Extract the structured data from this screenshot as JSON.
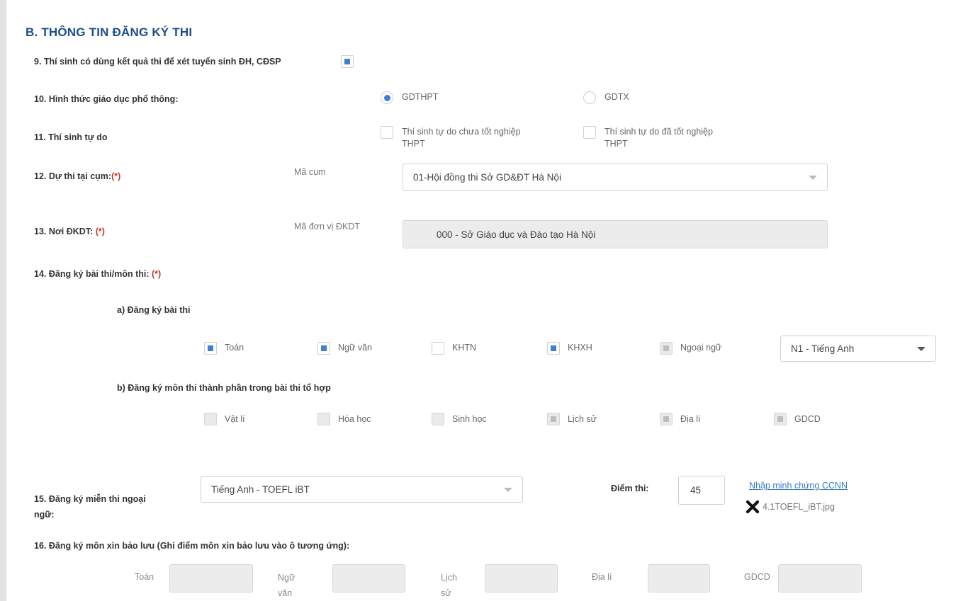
{
  "section_title": "B. THÔNG TIN ĐĂNG KÝ THI",
  "q9": {
    "label": "9. Thí sinh có dùng kết quả thi để xét tuyển sinh ĐH, CĐSP",
    "checked": true
  },
  "q10": {
    "label": "10. Hình thức giáo dục phổ thông:",
    "options": [
      {
        "label": "GDTHPT",
        "selected": true
      },
      {
        "label": "GDTX",
        "selected": false
      }
    ]
  },
  "q11": {
    "label": "11. Thí sinh tự do",
    "options": [
      {
        "line1": "Thí sinh tự do chưa tốt nghiệp",
        "line2": "THPT",
        "checked": false
      },
      {
        "line1": "Thí sinh tự do đã tốt nghiệp",
        "line2": "THPT",
        "checked": false
      }
    ]
  },
  "q12": {
    "label": "12. Dự thi tại cụm:",
    "required_mark": "(*)",
    "sub_label": "Mã cụm",
    "value": "01-Hội đồng thi Sở GD&ĐT Hà Nội"
  },
  "q13": {
    "label": "13. Nơi ĐKDT:",
    "required_mark": "(*)",
    "sub_label": "Mã đơn vị ĐKDT",
    "value": "000 - Sở Giáo dục và Đào tạo Hà Nội"
  },
  "q14": {
    "label": "14. Đăng ký bài thi/môn thi:",
    "required_mark": "(*)",
    "a_label": "a) Đăng ký bài thi",
    "a_items": [
      {
        "label": "Toán",
        "checked": true,
        "disabled": false
      },
      {
        "label": "Ngữ văn",
        "checked": true,
        "disabled": false
      },
      {
        "label": "KHTN",
        "checked": false,
        "disabled": false
      },
      {
        "label": "KHXH",
        "checked": true,
        "disabled": false
      },
      {
        "label": "Ngoại ngữ",
        "checked": true,
        "disabled": true
      }
    ],
    "language_select": "N1 - Tiếng Anh",
    "b_label": "b) Đăng ký môn thi thành phần trong bài thi tổ hợp",
    "b_items": [
      {
        "label": "Vật lí",
        "checked": false
      },
      {
        "label": "Hóa học",
        "checked": false
      },
      {
        "label": "Sinh học",
        "checked": false
      },
      {
        "label": "Lịch sử",
        "checked": true
      },
      {
        "label": "Địa lí",
        "checked": true
      },
      {
        "label": "GDCD",
        "checked": true
      }
    ]
  },
  "q15": {
    "label_line1": "15. Đăng ký miễn thi ngoại",
    "label_line2": "ngữ:",
    "value": "Tiếng Anh - TOEFL iBT",
    "score_label": "Điểm thi:",
    "score_value": "45",
    "link_text": "Nhập minh chứng CCNN",
    "file_name": "4.1TOEFL_iBT.jpg"
  },
  "q16": {
    "label": "16. Đăng ký môn xin bảo lưu (Ghi điểm môn xin bảo lưu vào ô tương ứng):",
    "fields": [
      {
        "line1": "Toán",
        "line2": ""
      },
      {
        "line1": "Ngữ",
        "line2": "văn"
      },
      {
        "line1": "Lịch",
        "line2": "sử"
      },
      {
        "line1": "Địa lí",
        "line2": ""
      },
      {
        "line1": "GDCD",
        "line2": ""
      }
    ]
  },
  "colors": {
    "accent": "#3f7fd0",
    "title": "#1b4e8a",
    "required": "#c0392b",
    "link": "#3a7bc8"
  }
}
